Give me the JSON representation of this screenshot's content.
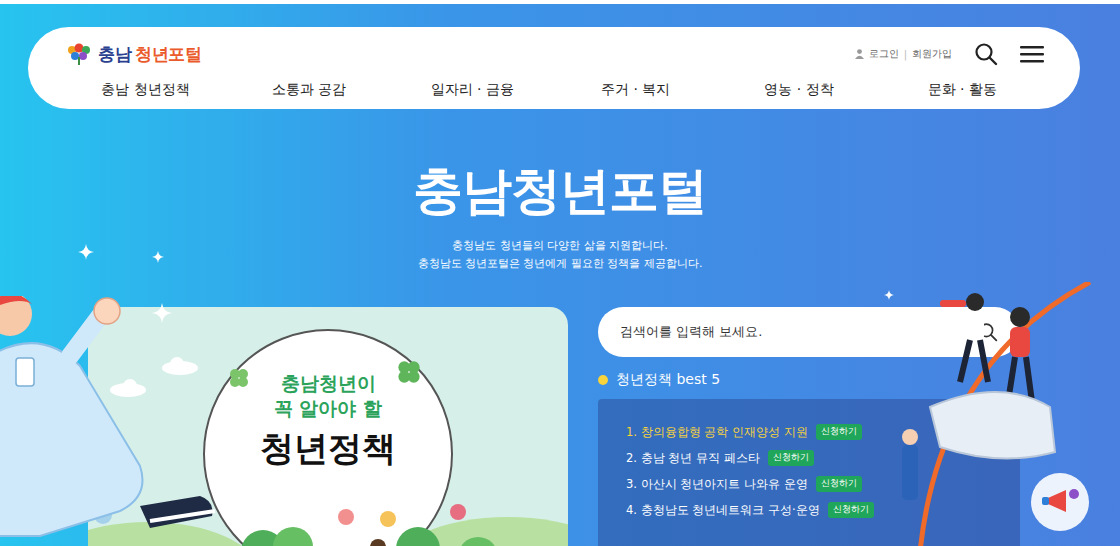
{
  "logo": {
    "part_a": "충남",
    "part_b": "청년포털"
  },
  "header": {
    "login": "로그인",
    "separator": "|",
    "signup": "회원가입"
  },
  "nav": [
    {
      "label": "충남 청년정책"
    },
    {
      "label": "소통과 공감"
    },
    {
      "label": "일자리 · 금융"
    },
    {
      "label": "주거 · 복지"
    },
    {
      "label": "영농 · 정착"
    },
    {
      "label": "문화 · 활동"
    }
  ],
  "hero": {
    "title": "충남청년포털",
    "subtitle": [
      "충청남도 청년들의 다양한 삶을 지원합니다.",
      "충청남도 청년포털은 청년에게 필요한 정책을 제공합니다."
    ]
  },
  "banner": {
    "line1": "충남청년이",
    "line2": "꼭 알아야 할",
    "title": "청년정책"
  },
  "search": {
    "placeholder": "검색어를 입력해 보세요."
  },
  "best": {
    "title": "청년정책 best 5",
    "items": [
      {
        "rank": "1.",
        "label": "창의융합형 공학 인재양성 지원",
        "badge": "신청하기",
        "selected": true
      },
      {
        "rank": "2.",
        "label": "충남 청년 뮤직 페스타",
        "badge": "신청하기",
        "selected": false
      },
      {
        "rank": "3.",
        "label": "아산시 청년아지트 나와유 운영",
        "badge": "신청하기",
        "selected": false
      },
      {
        "rank": "4.",
        "label": "충청남도 청년네트워크 구성·운영",
        "badge": "신청하기",
        "selected": false
      }
    ]
  }
}
